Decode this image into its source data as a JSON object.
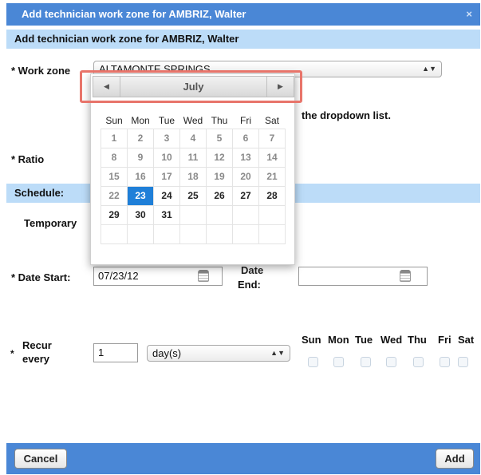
{
  "dialog": {
    "title": "Add technician work zone for AMBRIZ, Walter",
    "close_glyph": "×",
    "subtitle": "Add technician work zone for AMBRIZ, Walter"
  },
  "form": {
    "work_zone_label": "* Work zone",
    "work_zone_value": "ALTAMONTE SPRINGS",
    "helper_text": "the dropdown list.",
    "ratio_label": "* Ratio",
    "schedule_label": "Schedule:",
    "temporary_label": "Temporary",
    "date_start_label": "* Date Start:",
    "date_start_value": "07/23/12",
    "date_end_label_1": "Date",
    "date_end_label_2": "End:",
    "recur_star": "*",
    "recur_label_1": "Recur",
    "recur_label_2": "every",
    "recur_value": "1",
    "recur_unit": "day(s)",
    "weekdays": [
      "Sun",
      "Mon",
      "Tue",
      "Wed",
      "Thu",
      "Fri",
      "Sat"
    ]
  },
  "datepicker": {
    "month": "July",
    "prev_glyph": "◀",
    "next_glyph": "▶",
    "day_headers": [
      "Sun",
      "Mon",
      "Tue",
      "Wed",
      "Thu",
      "Fri",
      "Sat"
    ],
    "weeks": [
      [
        "1",
        "2",
        "3",
        "4",
        "5",
        "6",
        "7"
      ],
      [
        "8",
        "9",
        "10",
        "11",
        "12",
        "13",
        "14"
      ],
      [
        "15",
        "16",
        "17",
        "18",
        "19",
        "20",
        "21"
      ],
      [
        "22",
        "23",
        "24",
        "25",
        "26",
        "27",
        "28"
      ],
      [
        "29",
        "30",
        "31",
        "",
        "",
        "",
        ""
      ],
      [
        "",
        "",
        "",
        "",
        "",
        "",
        ""
      ]
    ],
    "selected_day": "23",
    "past_days": [
      "1",
      "2",
      "3",
      "4",
      "5",
      "6",
      "7",
      "8",
      "9",
      "10",
      "11",
      "12",
      "13",
      "14",
      "15",
      "16",
      "17",
      "18",
      "19",
      "20",
      "21",
      "22"
    ]
  },
  "footer": {
    "cancel_label": "Cancel",
    "add_label": "Add"
  },
  "colors": {
    "titlebar": "#4a87d6",
    "section": "#bcdcf8",
    "selected_day": "#1f7fd8",
    "highlight": "#e8746a"
  }
}
